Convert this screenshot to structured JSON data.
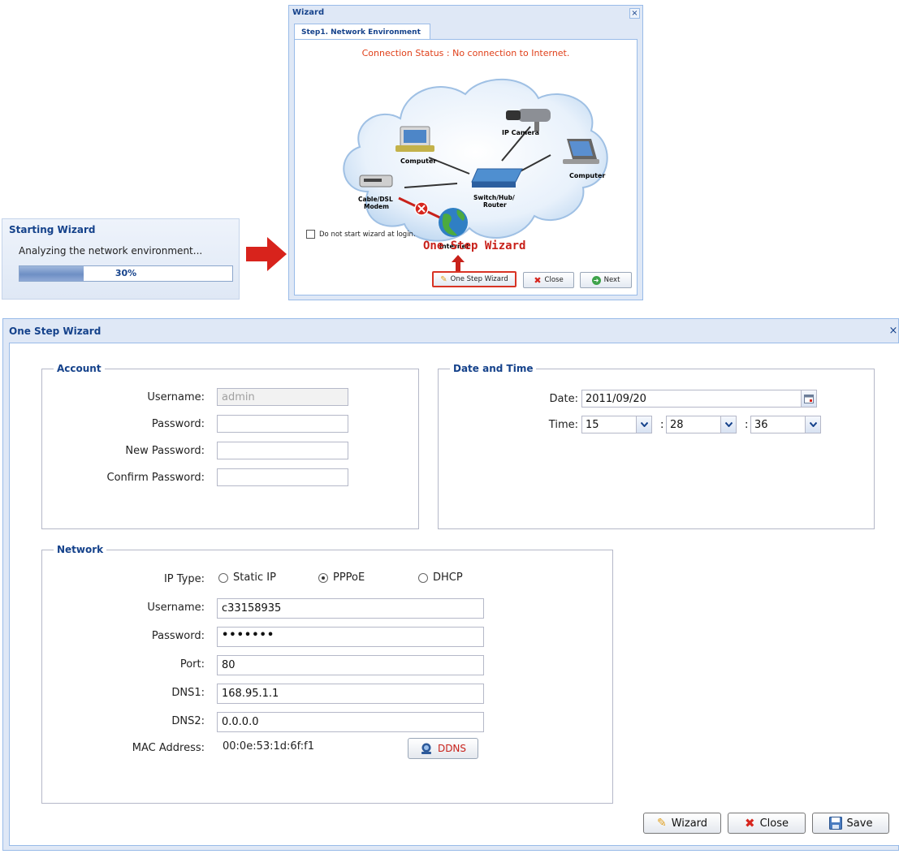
{
  "starting_wizard": {
    "title": "Starting Wizard",
    "message": "Analyzing the network environment...",
    "progress_fraction": 0.3,
    "progress_label": "30%"
  },
  "wizard": {
    "title": "Wizard",
    "close_glyph": "×",
    "tab": "Step1. Network Environment",
    "status": "Connection Status : No connection to Internet.",
    "diagram_labels": {
      "ip_camera": "IP Camera",
      "computer_left": "Computer",
      "computer_right": "Computer",
      "modem_line1": "Cable/DSL",
      "modem_line2": "Modem",
      "switch_line1": "Switch/Hub/",
      "switch_line2": "Router",
      "internet": "Internet"
    },
    "checkbox_label": "Do not start wizard at login.",
    "annotation": "One Step Wizard",
    "buttons": {
      "one_step": "One Step Wizard",
      "close": "Close",
      "next": "Next"
    }
  },
  "one_step": {
    "title": "One Step Wizard",
    "close_glyph": "×",
    "account": {
      "legend": "Account",
      "username_label": "Username:",
      "username_value": "admin",
      "password_label": "Password:",
      "password_value": "",
      "new_password_label": "New Password:",
      "new_password_value": "",
      "confirm_password_label": "Confirm Password:",
      "confirm_password_value": ""
    },
    "datetime": {
      "legend": "Date and Time",
      "date_label": "Date:",
      "date_value": "2011/09/20",
      "time_label": "Time:",
      "hour": "15",
      "minute_sep": ":",
      "minute": "28",
      "second_sep": ":",
      "second": "36"
    },
    "network": {
      "legend": "Network",
      "ip_type_label": "IP Type:",
      "ip_options": [
        "Static IP",
        "PPPoE",
        "DHCP"
      ],
      "ip_selected": "PPPoE",
      "username_label": "Username:",
      "username_value": "c33158935",
      "password_label": "Password:",
      "password_value": "•••••••",
      "port_label": "Port:",
      "port_value": "80",
      "dns1_label": "DNS1:",
      "dns1_value": "168.95.1.1",
      "dns2_label": "DNS2:",
      "dns2_value": "0.0.0.0",
      "mac_label": "MAC Address:",
      "mac_value": "00:0e:53:1d:6f:f1",
      "ddns_button": "DDNS"
    },
    "buttons": {
      "wizard": "Wizard",
      "close": "Close",
      "save": "Save"
    }
  },
  "colors": {
    "title_blue": "#15428b",
    "panel_bg": "#dfe8f6",
    "status_red": "#e0401a",
    "accent_red": "#c8211a"
  }
}
